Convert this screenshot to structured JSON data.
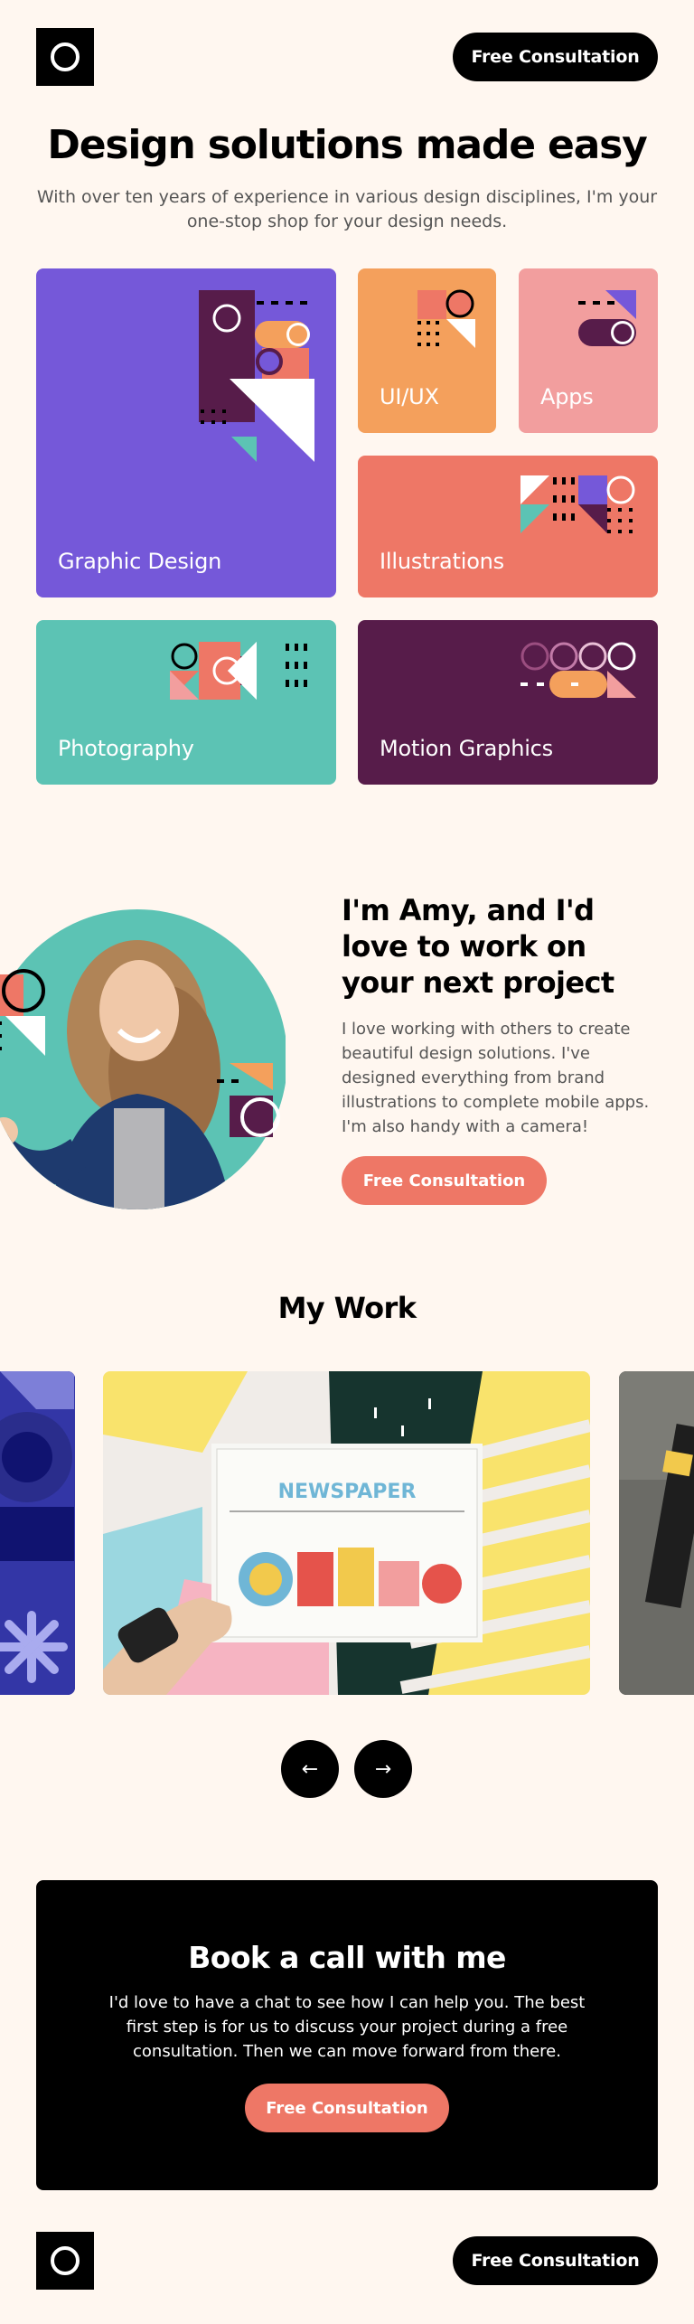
{
  "header": {
    "logo_name": "ring-logo",
    "cta_label": "Free Consultation"
  },
  "hero": {
    "title": "Design solutions made easy",
    "subtitle": "With over ten years of experience in various design disciplines, I'm your one-stop shop for your design needs."
  },
  "services": [
    {
      "label": "Graphic Design",
      "color": "#7558D9"
    },
    {
      "label": "UI/UX",
      "color": "#F4A05C"
    },
    {
      "label": "Apps",
      "color": "#F29E9E"
    },
    {
      "label": "Illustrations",
      "color": "#EE7766"
    },
    {
      "label": "Photography",
      "color": "#5CC3B4"
    },
    {
      "label": "Motion Graphics",
      "color": "#571C4A"
    }
  ],
  "about": {
    "title": "I'm Amy, and I'd love to work on your next project",
    "text": "I love working with others to create beautiful design solutions. I've designed everything from brand illustrations to complete mobile apps. I'm also handy with a camera!",
    "cta_label": "Free Consultation"
  },
  "work": {
    "title": "My Work",
    "prev_icon": "arrow-left-icon",
    "next_icon": "arrow-right-icon",
    "featured_caption": "NEWSPAPER"
  },
  "book": {
    "title": "Book a call with me",
    "text": "I'd love to have a chat to see how I can help you. The best first step is for us to discuss your project during a free consultation. Then we can move forward from there.",
    "cta_label": "Free Consultation"
  },
  "footer": {
    "cta_label": "Free Consultation"
  },
  "colors": {
    "background": "#FFF7F0",
    "coral": "#EE7766",
    "purple": "#7558D9",
    "teal": "#5CC3B4",
    "dark_plum": "#571C4A",
    "orange": "#F4A05C",
    "pink": "#F29E9E"
  }
}
